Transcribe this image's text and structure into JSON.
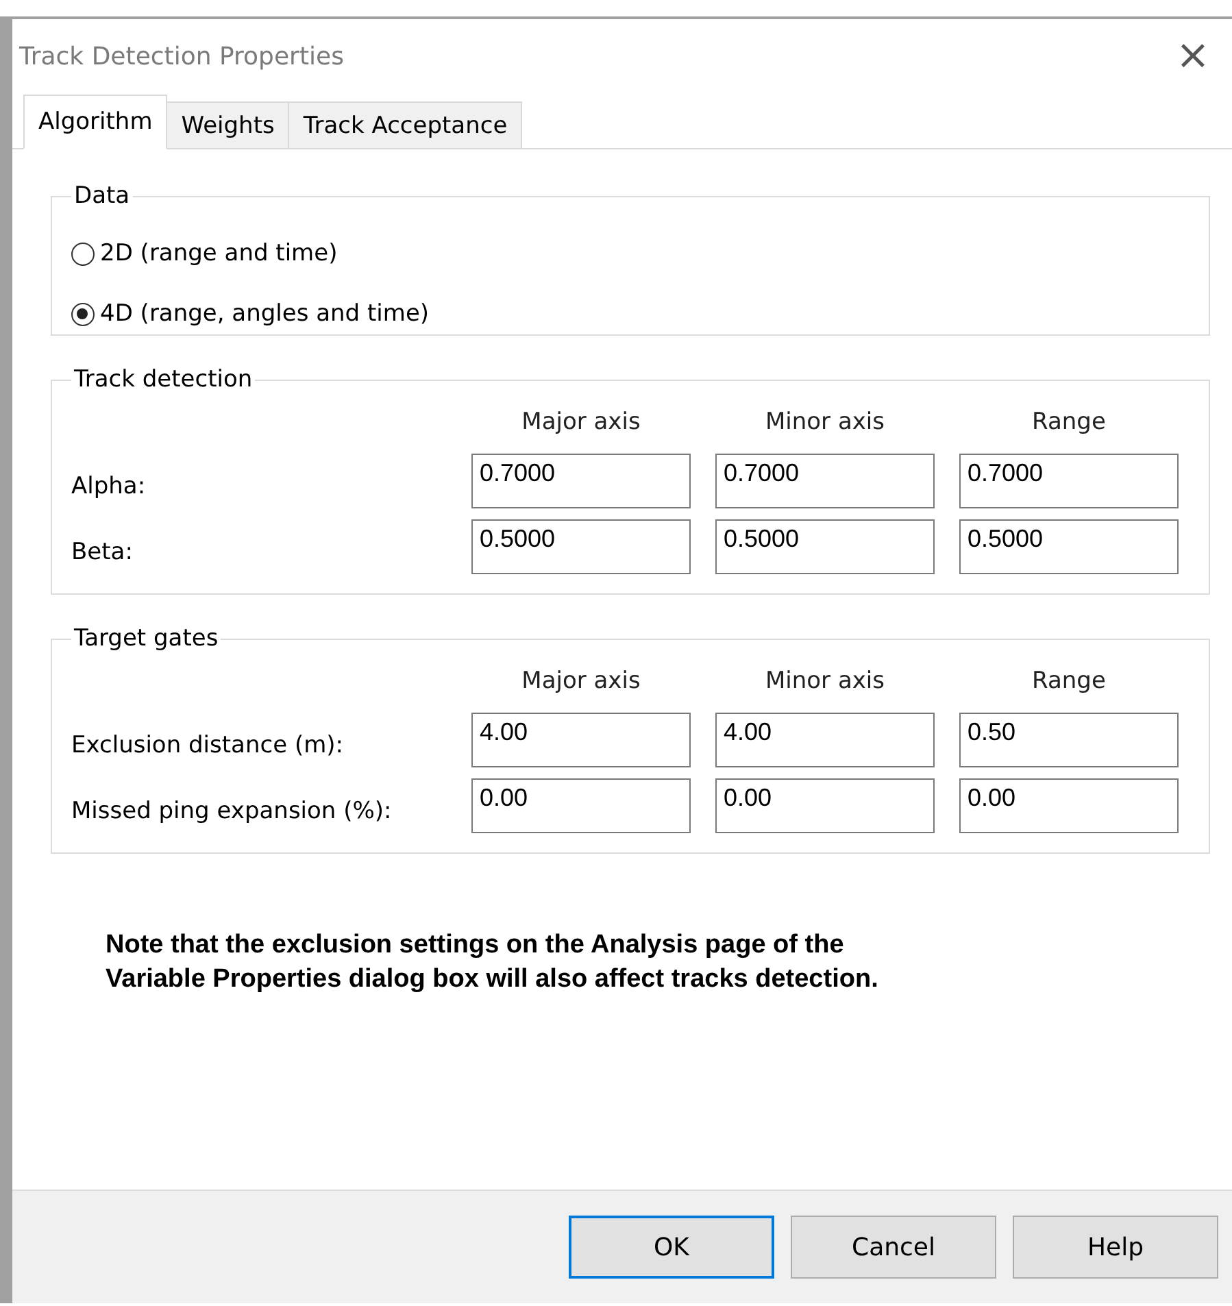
{
  "window": {
    "title": "Track Detection Properties",
    "close": "×"
  },
  "tabs": [
    {
      "label": "Algorithm",
      "selected": true
    },
    {
      "label": "Weights",
      "selected": false
    },
    {
      "label": "Track Acceptance",
      "selected": false
    }
  ],
  "data_group": {
    "title": "Data",
    "options": [
      {
        "label": "2D (range and time)",
        "selected": false
      },
      {
        "label": "4D (range, angles and time)",
        "selected": true
      }
    ]
  },
  "track_detection": {
    "title": "Track detection",
    "columns": [
      "Major axis",
      "Minor axis",
      "Range"
    ],
    "rows": [
      {
        "label": "Alpha:",
        "values": [
          "0.7000",
          "0.7000",
          "0.7000"
        ]
      },
      {
        "label": "Beta:",
        "values": [
          "0.5000",
          "0.5000",
          "0.5000"
        ]
      }
    ]
  },
  "target_gates": {
    "title": "Target gates",
    "columns": [
      "Major axis",
      "Minor axis",
      "Range"
    ],
    "rows": [
      {
        "label": "Exclusion distance (m):",
        "values": [
          "4.00",
          "4.00",
          "0.50"
        ]
      },
      {
        "label": "Missed ping expansion (%):",
        "values": [
          "0.00",
          "0.00",
          "0.00"
        ]
      }
    ]
  },
  "note": "Note that the exclusion settings on the Analysis page of the\nVariable Properties dialog box will also affect tracks detection.",
  "buttons": [
    {
      "label": "OK",
      "default": true
    },
    {
      "label": "Cancel",
      "default": false
    },
    {
      "label": "Help",
      "default": false
    }
  ]
}
